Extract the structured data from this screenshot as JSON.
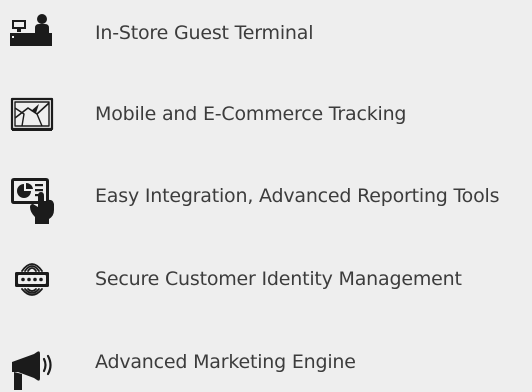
{
  "icon_color": "#1b1b1b",
  "text_color": "#3c3c3c",
  "background_color": "#eeeeee",
  "features": [
    {
      "icon": "guest-terminal-icon",
      "label": "In-Store Guest Terminal"
    },
    {
      "icon": "map-tracking-icon",
      "label": "Mobile and E-Commerce Tracking"
    },
    {
      "icon": "reporting-touch-icon",
      "label": "Easy Integration, Advanced Reporting Tools"
    },
    {
      "icon": "secure-identity-icon",
      "label": "Secure Customer Identity Management"
    },
    {
      "icon": "megaphone-icon",
      "label": "Advanced Marketing Engine"
    }
  ]
}
